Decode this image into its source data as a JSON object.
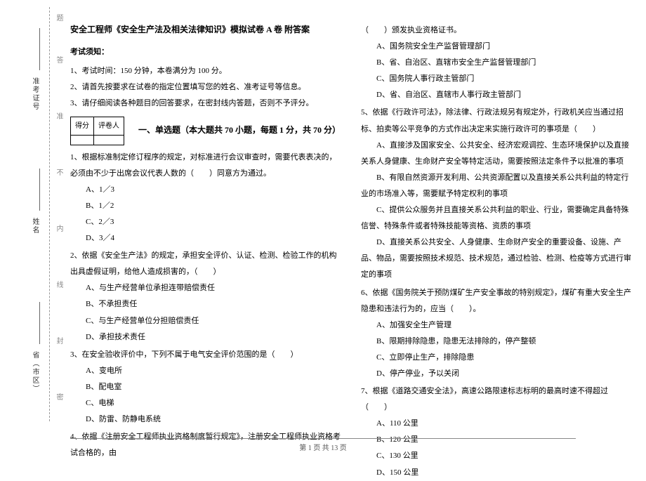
{
  "binding": {
    "fields": [
      {
        "label": "省（市区）"
      },
      {
        "label": "姓名"
      },
      {
        "label": "准考证号"
      }
    ],
    "marks": [
      "密",
      "封",
      "线",
      "内",
      "不",
      "准",
      "答",
      "题"
    ]
  },
  "header": {
    "title": "安全工程师《安全生产法及相关法律知识》模拟试卷 A 卷  附答案"
  },
  "notice": {
    "head": "考试须知：",
    "items": [
      "1、考试时间：150 分钟，本卷满分为 100 分。",
      "2、请首先按要求在试卷的指定位置填写您的姓名、准考证号等信息。",
      "3、请仔细阅读各种题目的回答要求，在密封线内答题，否则不予评分。"
    ]
  },
  "score_table": {
    "h1": "得分",
    "h2": "评卷人"
  },
  "section1": {
    "title": "一、单选题（本大题共 70 小题，每题 1 分，共 70 分）"
  },
  "q1": {
    "stem": "1、根据标准制定修订程序的规定，对标准进行会议审查时，需要代表表决的，必须由不少于出席会议代表人数的（　　）同意方为通过。",
    "opts": [
      "A、1／3",
      "B、1／2",
      "C、2／3",
      "D、3／4"
    ]
  },
  "q2": {
    "stem": "2、依据《安全生产法》的规定，承担安全评价、认证、检测、检验工作的机构出具虚假证明，给他人造成损害的，（　　）",
    "opts": [
      "A、与生产经营单位承担连带赔偿责任",
      "B、不承担责任",
      "C、与生产经营单位分担赔偿责任",
      "D、承担技术责任"
    ]
  },
  "q3": {
    "stem": "3、在安全验收评价中，下列不属于电气安全评价范围的是（　　）",
    "opts": [
      "A、变电所",
      "B、配电室",
      "C、电梯",
      "D、防雷、防静电系统"
    ]
  },
  "q4": {
    "stem": "4、依据《注册安全工程师执业资格制度暂行规定》，注册安全工程师执业资格考试合格的，由"
  },
  "q4_cont": {
    "tail": "（　　）颁发执业资格证书。",
    "opts": [
      "A、国务院安全生产监督管理部门",
      "B、省、自治区、直辖市安全生产监督管理部门",
      "C、国务院人事行政主管部门",
      "D、省、自治区、直辖市人事行政主管部门"
    ]
  },
  "q5": {
    "stem": "5、依据《行政许可法》，除法律、行政法规另有规定外，行政机关应当通过招标、拍卖等公平竞争的方式作出决定来实施行政许可的事项是（　　）",
    "opts": [
      "A、直接涉及国家安全、公共安全、经济宏观调控、生态环境保护以及直接关系人身健康、生命财产安全等特定活动，需要按照法定条件予以批准的事项",
      "B、有限自然资源开发利用、公共资源配置以及直接关系公共利益的特定行业的市场准入等，需要赋予特定权利的事项",
      "C、提供公众服务并且直接关系公共利益的职业、行业，需要确定具备特殊信誉、特殊条件或者特殊技能等资格、资质的事项",
      "D、直接关系公共安全、人身健康、生命财产安全的重要设备、设施、产品、物品，需要按照技术规范、技术规范，通过检验、检测、检疫等方式进行审定的事项"
    ]
  },
  "q6": {
    "stem": "6、依据《国务院关于预防煤矿生产安全事故的特别规定》，煤矿有重大安全生产隐患和违法行为的，应当（　　）。",
    "opts": [
      "A、加强安全生产管理",
      "B、限期排除隐患，隐患无法排除的，停产整顿",
      "C、立即停止生产，排除隐患",
      "D、停产停业，予以关闭"
    ]
  },
  "q7": {
    "stem": "7、根据《道路交通安全法》，高速公路限速标志标明的最高时速不得超过（　　）",
    "opts": [
      "A、110 公里",
      "B、120 公里",
      "C、130 公里",
      "D、150 公里"
    ]
  },
  "footer": {
    "text": "第 1 页 共 13 页"
  }
}
